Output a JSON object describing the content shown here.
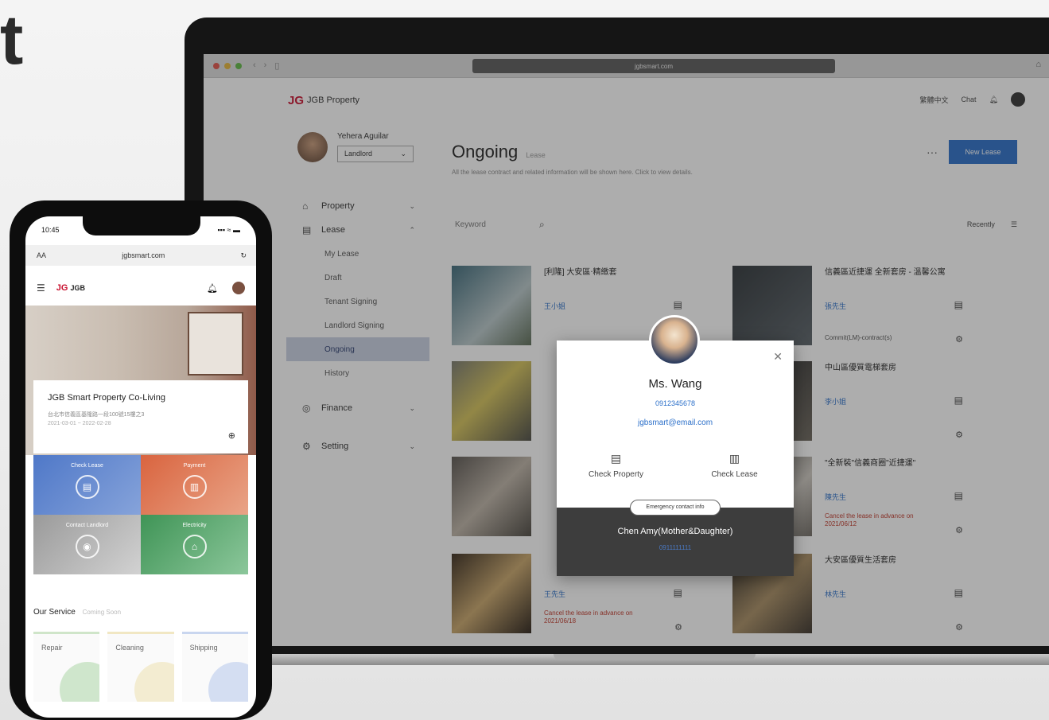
{
  "hero_letter": "t",
  "browser": {
    "url": "jgbsmart.com"
  },
  "desktop": {
    "logo_mark": "JG",
    "logo_text": "JGB Property",
    "header_links": [
      "繁體中文",
      "Chat"
    ],
    "profile": {
      "name": "Yehera Aguilar",
      "select": "Landlord"
    },
    "menu": [
      {
        "label": "Property",
        "icon": "home-icon",
        "children": []
      },
      {
        "label": "Lease",
        "icon": "document-icon",
        "children": [
          "My Lease",
          "Draft",
          "Tenant Signing",
          "Landlord Signing",
          "Ongoing",
          "History"
        ]
      },
      {
        "label": "Finance",
        "icon": "wallet-icon",
        "children": []
      },
      {
        "label": "Setting",
        "icon": "gear-icon",
        "children": []
      }
    ],
    "active_submenu": "Ongoing",
    "page": {
      "title": "Ongoing",
      "title_tag": "Lease",
      "description": "All the lease contract and related information will be shown here. Click to view details.",
      "new_button": "New Lease",
      "search_placeholder": "Keyword",
      "sort_label": "Recently"
    },
    "cards": [
      {
        "title": "[利隆] 大安區‧精緻套",
        "link": "王小姐",
        "note": ""
      },
      {
        "title": "信義區近捷運 全新套房 - 溫馨公寓",
        "link": "張先生",
        "note": "Commit(LM)-contract(s)"
      },
      {
        "title": "",
        "link": "",
        "note": ""
      },
      {
        "title": "中山區優質電梯套房",
        "link": "李小姐",
        "note": ""
      },
      {
        "title": "",
        "link": "",
        "note": ""
      },
      {
        "title": "\"全新裝\"信義商圈\"近捷運\"",
        "link": "陳先生",
        "note": "Cancel the lease in advance on 2021/06/12"
      },
      {
        "title": "",
        "link": "王先生",
        "note": "Cancel the lease in advance on 2021/06/18"
      },
      {
        "title": "大安區優質生活套房",
        "link": "林先生",
        "note": ""
      }
    ],
    "popup": {
      "name": "Ms. Wang",
      "phone": "0912345678",
      "email": "jgbsmart@email.com",
      "actions": [
        "Check Property",
        "Check Lease"
      ],
      "chip": "Emergency contact info",
      "footer_name": "Chen Amy(Mother&Daughter)",
      "footer_sub": "0911111111"
    }
  },
  "phone": {
    "time": "10:45",
    "signal": "▪▪▪ ≈ ▬",
    "aa": "AA",
    "url": "jgbsmart.com",
    "logo_mark": "JG",
    "logo_text": "JGB",
    "hero_card": {
      "title": "JGB Smart Property Co-Living",
      "line1": "台北市信義區基隆路一段100號15樓之3",
      "line2": "2021-03-01 ~ 2022-02-28"
    },
    "tiles": [
      {
        "label": "Check Lease",
        "icon": "document-icon"
      },
      {
        "label": "Payment",
        "icon": "wallet-icon"
      },
      {
        "label": "Contact Landlord",
        "icon": "chat-icon"
      },
      {
        "label": "Electricity",
        "icon": "home-icon"
      }
    ],
    "section_title": "Our Service",
    "section_sub": "Coming Soon",
    "services": [
      "Repair",
      "Cleaning",
      "Shipping"
    ]
  }
}
